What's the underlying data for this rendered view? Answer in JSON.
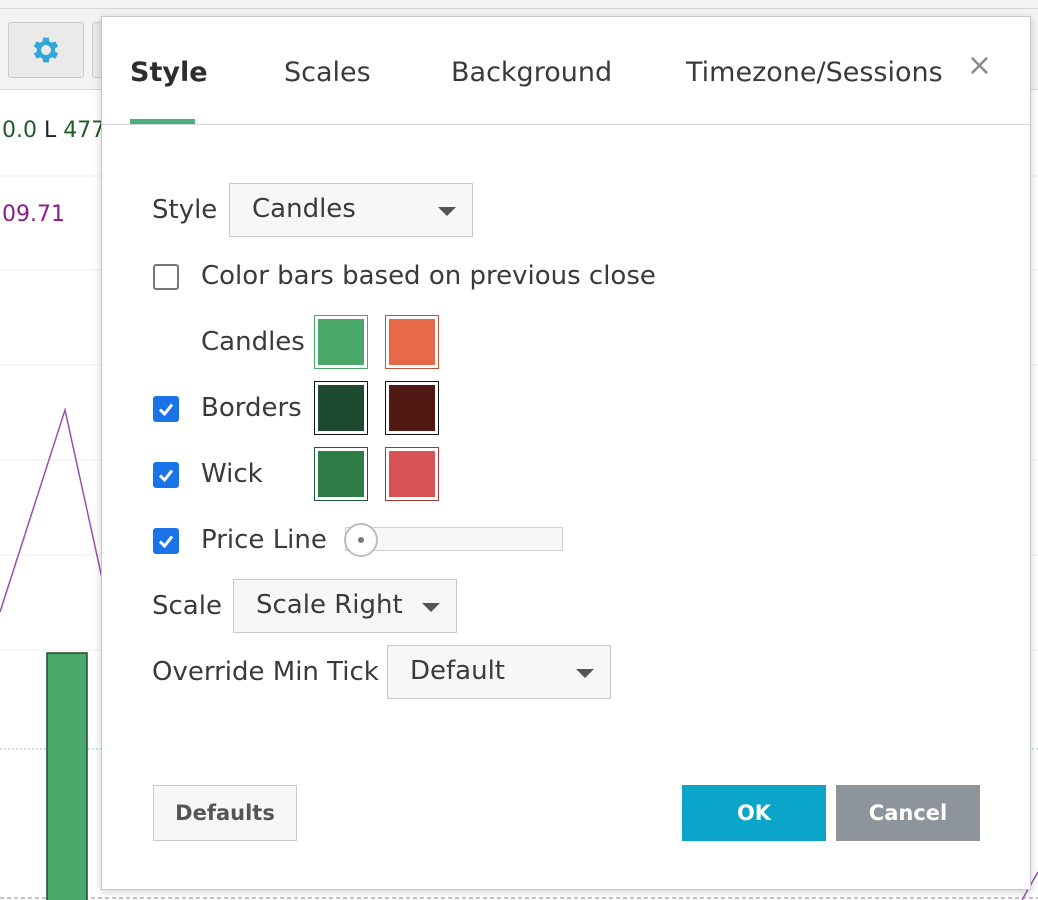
{
  "background": {
    "legend_ohlc": {
      "value_prefix": "0.0",
      "low_label": "L",
      "low_value": "477"
    },
    "legend_indicator": {
      "value": "09.71"
    },
    "colors": {
      "up": "#4aa86a",
      "down": "#e05a3e",
      "indicator": "#9a4fb0"
    }
  },
  "dialog": {
    "tabs": [
      {
        "label": "Style",
        "active": true
      },
      {
        "label": "Scales",
        "active": false
      },
      {
        "label": "Background",
        "active": false
      },
      {
        "label": "Timezone/Sessions",
        "active": false
      }
    ],
    "close_label": "×",
    "style": {
      "label": "Style",
      "select_value": "Candles"
    },
    "color_bars_prev_close": {
      "label": "Color bars based on previous close",
      "checked": false
    },
    "candles": {
      "label": "Candles",
      "up_color": "#4aa86a",
      "down_color": "#e8694a"
    },
    "borders": {
      "label": "Borders",
      "checked": true,
      "up_color": "#1e4a30",
      "down_color": "#521914"
    },
    "wick": {
      "label": "Wick",
      "checked": true,
      "up_color": "#2e7d46",
      "down_color": "#d85454"
    },
    "price_line": {
      "label": "Price Line",
      "checked": true,
      "slider_level": 0
    },
    "scale": {
      "label": "Scale",
      "select_value": "Scale Right"
    },
    "override_min_tick": {
      "label": "Override Min Tick",
      "select_value": "Default"
    },
    "buttons": {
      "defaults": "Defaults",
      "ok": "OK",
      "cancel": "Cancel"
    }
  }
}
